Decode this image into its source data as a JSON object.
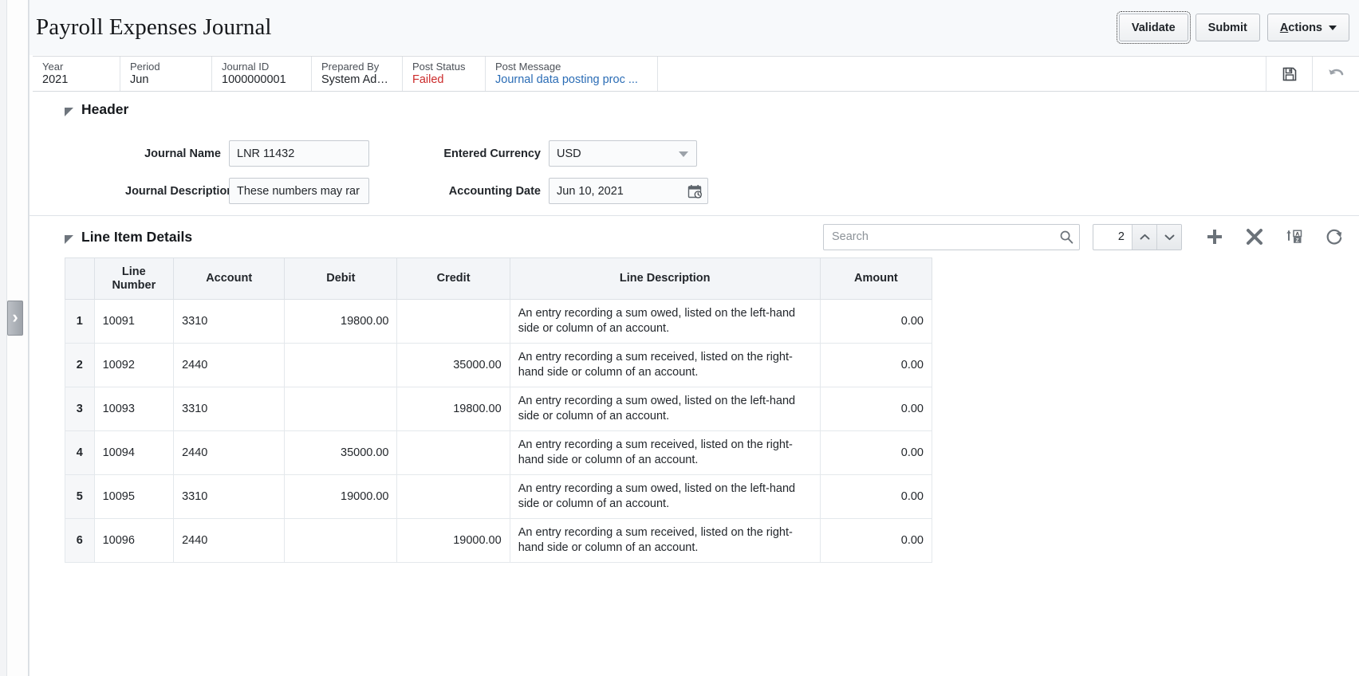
{
  "page": {
    "title": "Payroll Expenses Journal"
  },
  "toolbar": {
    "validate_label": "Validate",
    "submit_label": "Submit",
    "actions_label": "Actions",
    "actions_accesskey": "A",
    "actions_rest": "ctions",
    "save_icon": "save-icon",
    "undo_icon": "undo-icon"
  },
  "info_strip": [
    {
      "key": "Year",
      "value": "2021",
      "style": "plain"
    },
    {
      "key": "Period",
      "value": "Jun",
      "style": "plain"
    },
    {
      "key": "Journal ID",
      "value": "1000000001",
      "style": "plain"
    },
    {
      "key": "Prepared By",
      "value": "System Admin",
      "style": "plain"
    },
    {
      "key": "Post Status",
      "value": "Failed",
      "style": "failed"
    },
    {
      "key": "Post Message",
      "value": "Journal data posting proc ...",
      "style": "link"
    }
  ],
  "header_section": {
    "title": "Header",
    "fields": {
      "journal_name_label": "Journal Name",
      "journal_name_value": "LNR 11432",
      "journal_description_label": "Journal Description",
      "journal_description_value": "These numbers may rar",
      "entered_currency_label": "Entered Currency",
      "entered_currency_value": "USD",
      "accounting_date_label": "Accounting Date",
      "accounting_date_value": "Jun 10, 2021"
    }
  },
  "lines_section": {
    "title": "Line Item Details",
    "search_placeholder": "Search",
    "search_value": "",
    "row_spinner_value": "2",
    "icons": {
      "search": "search-icon",
      "spin_up": "chevron-up-icon",
      "spin_down": "chevron-down-icon",
      "add": "plus-icon",
      "delete": "close-x-icon",
      "sort": "sort-az-icon",
      "refresh": "refresh-icon"
    },
    "columns": [
      "Line Number",
      "Account",
      "Debit",
      "Credit",
      "Line Description",
      "Amount"
    ],
    "rows": [
      {
        "n": "1",
        "line_number": "10091",
        "account": "3310",
        "debit": "19800.00",
        "credit": "",
        "description": "An entry recording a sum owed, listed on the left-hand side or column of an account.",
        "amount": "0.00"
      },
      {
        "n": "2",
        "line_number": "10092",
        "account": "2440",
        "debit": "",
        "credit": "35000.00",
        "description": "An entry recording a sum received, listed on the right-hand side or column of an account.",
        "amount": "0.00"
      },
      {
        "n": "3",
        "line_number": "10093",
        "account": "3310",
        "debit": "",
        "credit": "19800.00",
        "description": "An entry recording a sum owed, listed on the left-hand side or column of an account.",
        "amount": "0.00"
      },
      {
        "n": "4",
        "line_number": "10094",
        "account": "2440",
        "debit": "35000.00",
        "credit": "",
        "description": "An entry recording a sum received, listed on the right-hand side or column of an account.",
        "amount": "0.00"
      },
      {
        "n": "5",
        "line_number": "10095",
        "account": "3310",
        "debit": "19000.00",
        "credit": "",
        "description": "An entry recording a sum owed, listed on the left-hand side or column of an account.",
        "amount": "0.00"
      },
      {
        "n": "6",
        "line_number": "10096",
        "account": "2440",
        "debit": "",
        "credit": "19000.00",
        "description": "An entry recording a sum received, listed on the right-hand side or column of an account.",
        "amount": "0.00"
      }
    ]
  },
  "colors": {
    "accent_link": "#2a6cb5",
    "status_failed": "#cc2b2b",
    "header_band": "#f7f9fb",
    "grid_header": "#f3f5f8"
  }
}
